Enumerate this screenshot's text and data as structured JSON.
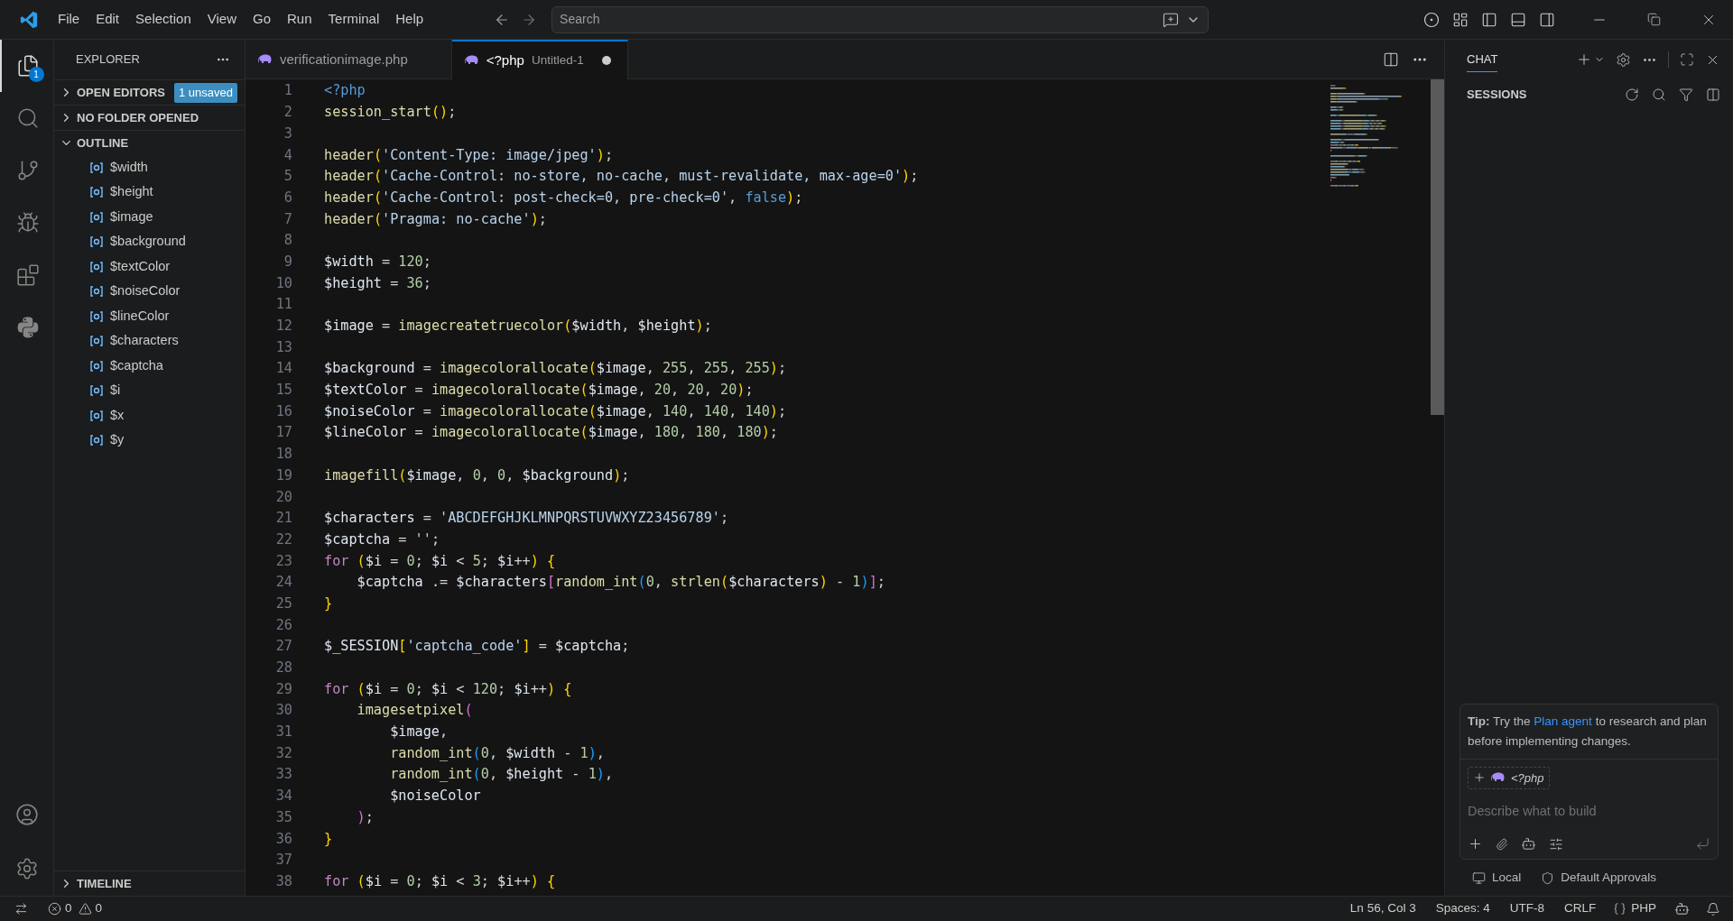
{
  "title_bar": {
    "menu": [
      "File",
      "Edit",
      "Selection",
      "View",
      "Go",
      "Run",
      "Terminal",
      "Help"
    ],
    "search": {
      "placeholder": "Search"
    }
  },
  "activity_bar": {
    "items": [
      {
        "kind": "files",
        "selected": true,
        "badge": "1"
      },
      {
        "kind": "search",
        "selected": false
      },
      {
        "kind": "source-control",
        "selected": false
      },
      {
        "kind": "run-debug",
        "selected": false
      },
      {
        "kind": "extensions",
        "selected": false
      },
      {
        "kind": "python",
        "selected": false
      }
    ],
    "bottom": [
      {
        "kind": "account"
      },
      {
        "kind": "settings"
      }
    ]
  },
  "sidebar": {
    "title": "EXPLORER",
    "sections": [
      {
        "label": "OPEN EDITORS",
        "expanded": false,
        "badge": "1 unsaved"
      },
      {
        "label": "NO FOLDER OPENED",
        "expanded": false
      },
      {
        "label": "OUTLINE",
        "expanded": true,
        "items": [
          "$width",
          "$height",
          "$image",
          "$background",
          "$textColor",
          "$noiseColor",
          "$lineColor",
          "$characters",
          "$captcha",
          "$i",
          "$x",
          "$y"
        ]
      },
      {
        "label": "TIMELINE",
        "expanded": false
      }
    ]
  },
  "editor": {
    "tabs": [
      {
        "label": "verificationimage.php",
        "selected": false,
        "modified": false
      },
      {
        "label": "<?php",
        "description": "Untitled-1",
        "selected": true,
        "modified": true
      }
    ],
    "lines": [
      {
        "number": "1",
        "tokens": [
          {
            "kind": "k",
            "text": "<?php"
          }
        ]
      },
      {
        "number": "2",
        "tokens": [
          {
            "kind": "f",
            "text": "session_start"
          },
          {
            "kind": "b1",
            "text": "()"
          },
          {
            "kind": "p",
            "text": ";"
          }
        ]
      },
      {
        "number": "3"
      },
      {
        "number": "4",
        "tokens": [
          {
            "kind": "f",
            "text": "header"
          },
          {
            "kind": "b1",
            "text": "("
          },
          {
            "kind": "s",
            "text": "'Content-Type: image/jpeg'"
          },
          {
            "kind": "b1",
            "text": ")"
          },
          {
            "kind": "p",
            "text": ";"
          }
        ]
      },
      {
        "number": "5",
        "tokens": [
          {
            "kind": "f",
            "text": "header"
          },
          {
            "kind": "b1",
            "text": "("
          },
          {
            "kind": "s",
            "text": "'Cache-Control: no-store, no-cache, must-revalidate, max-age=0'"
          },
          {
            "kind": "b1",
            "text": ")"
          },
          {
            "kind": "p",
            "text": ";"
          }
        ]
      },
      {
        "number": "6",
        "tokens": [
          {
            "kind": "f",
            "text": "header"
          },
          {
            "kind": "b1",
            "text": "("
          },
          {
            "kind": "s",
            "text": "'Cache-Control: post-check=0, pre-check=0'"
          },
          {
            "kind": "p",
            "text": ", "
          },
          {
            "kind": "k",
            "text": "false"
          },
          {
            "kind": "b1",
            "text": ")"
          },
          {
            "kind": "p",
            "text": ";"
          }
        ]
      },
      {
        "number": "7",
        "tokens": [
          {
            "kind": "f",
            "text": "header"
          },
          {
            "kind": "b1",
            "text": "("
          },
          {
            "kind": "s",
            "text": "'Pragma: no-cache'"
          },
          {
            "kind": "b1",
            "text": ")"
          },
          {
            "kind": "p",
            "text": ";"
          }
        ]
      },
      {
        "number": "8"
      },
      {
        "number": "9",
        "tokens": [
          {
            "kind": "v",
            "text": "$width"
          },
          {
            "kind": "p",
            "text": " = "
          },
          {
            "kind": "n",
            "text": "120"
          },
          {
            "kind": "p",
            "text": ";"
          }
        ]
      },
      {
        "number": "10",
        "tokens": [
          {
            "kind": "v",
            "text": "$height"
          },
          {
            "kind": "p",
            "text": " = "
          },
          {
            "kind": "n",
            "text": "36"
          },
          {
            "kind": "p",
            "text": ";"
          }
        ]
      },
      {
        "number": "11"
      },
      {
        "number": "12",
        "tokens": [
          {
            "kind": "v",
            "text": "$image"
          },
          {
            "kind": "p",
            "text": " = "
          },
          {
            "kind": "f",
            "text": "imagecreatetruecolor"
          },
          {
            "kind": "b1",
            "text": "("
          },
          {
            "kind": "v",
            "text": "$width"
          },
          {
            "kind": "p",
            "text": ", "
          },
          {
            "kind": "v",
            "text": "$height"
          },
          {
            "kind": "b1",
            "text": ")"
          },
          {
            "kind": "p",
            "text": ";"
          }
        ]
      },
      {
        "number": "13"
      },
      {
        "number": "14",
        "tokens": [
          {
            "kind": "v",
            "text": "$background"
          },
          {
            "kind": "p",
            "text": " = "
          },
          {
            "kind": "f",
            "text": "imagecolorallocate"
          },
          {
            "kind": "b1",
            "text": "("
          },
          {
            "kind": "v",
            "text": "$image"
          },
          {
            "kind": "p",
            "text": ", "
          },
          {
            "kind": "n",
            "text": "255"
          },
          {
            "kind": "p",
            "text": ", "
          },
          {
            "kind": "n",
            "text": "255"
          },
          {
            "kind": "p",
            "text": ", "
          },
          {
            "kind": "n",
            "text": "255"
          },
          {
            "kind": "b1",
            "text": ")"
          },
          {
            "kind": "p",
            "text": ";"
          }
        ]
      },
      {
        "number": "15",
        "tokens": [
          {
            "kind": "v",
            "text": "$textColor"
          },
          {
            "kind": "p",
            "text": " = "
          },
          {
            "kind": "f",
            "text": "imagecolorallocate"
          },
          {
            "kind": "b1",
            "text": "("
          },
          {
            "kind": "v",
            "text": "$image"
          },
          {
            "kind": "p",
            "text": ", "
          },
          {
            "kind": "n",
            "text": "20"
          },
          {
            "kind": "p",
            "text": ", "
          },
          {
            "kind": "n",
            "text": "20"
          },
          {
            "kind": "p",
            "text": ", "
          },
          {
            "kind": "n",
            "text": "20"
          },
          {
            "kind": "b1",
            "text": ")"
          },
          {
            "kind": "p",
            "text": ";"
          }
        ]
      },
      {
        "number": "16",
        "tokens": [
          {
            "kind": "v",
            "text": "$noiseColor"
          },
          {
            "kind": "p",
            "text": " = "
          },
          {
            "kind": "f",
            "text": "imagecolorallocate"
          },
          {
            "kind": "b1",
            "text": "("
          },
          {
            "kind": "v",
            "text": "$image"
          },
          {
            "kind": "p",
            "text": ", "
          },
          {
            "kind": "n",
            "text": "140"
          },
          {
            "kind": "p",
            "text": ", "
          },
          {
            "kind": "n",
            "text": "140"
          },
          {
            "kind": "p",
            "text": ", "
          },
          {
            "kind": "n",
            "text": "140"
          },
          {
            "kind": "b1",
            "text": ")"
          },
          {
            "kind": "p",
            "text": ";"
          }
        ]
      },
      {
        "number": "17",
        "tokens": [
          {
            "kind": "v",
            "text": "$lineColor"
          },
          {
            "kind": "p",
            "text": " = "
          },
          {
            "kind": "f",
            "text": "imagecolorallocate"
          },
          {
            "kind": "b1",
            "text": "("
          },
          {
            "kind": "v",
            "text": "$image"
          },
          {
            "kind": "p",
            "text": ", "
          },
          {
            "kind": "n",
            "text": "180"
          },
          {
            "kind": "p",
            "text": ", "
          },
          {
            "kind": "n",
            "text": "180"
          },
          {
            "kind": "p",
            "text": ", "
          },
          {
            "kind": "n",
            "text": "180"
          },
          {
            "kind": "b1",
            "text": ")"
          },
          {
            "kind": "p",
            "text": ";"
          }
        ]
      },
      {
        "number": "18"
      },
      {
        "number": "19",
        "tokens": [
          {
            "kind": "f",
            "text": "imagefill"
          },
          {
            "kind": "b1",
            "text": "("
          },
          {
            "kind": "v",
            "text": "$image"
          },
          {
            "kind": "p",
            "text": ", "
          },
          {
            "kind": "n",
            "text": "0"
          },
          {
            "kind": "p",
            "text": ", "
          },
          {
            "kind": "n",
            "text": "0"
          },
          {
            "kind": "p",
            "text": ", "
          },
          {
            "kind": "v",
            "text": "$background"
          },
          {
            "kind": "b1",
            "text": ")"
          },
          {
            "kind": "p",
            "text": ";"
          }
        ]
      },
      {
        "number": "20"
      },
      {
        "number": "21",
        "tokens": [
          {
            "kind": "v",
            "text": "$characters"
          },
          {
            "kind": "p",
            "text": " = "
          },
          {
            "kind": "s",
            "text": "'ABCDEFGHJKLMNPQRSTUVWXYZ23456789'"
          },
          {
            "kind": "p",
            "text": ";"
          }
        ]
      },
      {
        "number": "22",
        "tokens": [
          {
            "kind": "v",
            "text": "$captcha"
          },
          {
            "kind": "p",
            "text": " = "
          },
          {
            "kind": "s",
            "text": "''"
          },
          {
            "kind": "p",
            "text": ";"
          }
        ]
      },
      {
        "number": "23",
        "tokens": [
          {
            "kind": "c",
            "text": "for "
          },
          {
            "kind": "b1",
            "text": "("
          },
          {
            "kind": "v",
            "text": "$i"
          },
          {
            "kind": "p",
            "text": " = "
          },
          {
            "kind": "n",
            "text": "0"
          },
          {
            "kind": "p",
            "text": "; "
          },
          {
            "kind": "v",
            "text": "$i"
          },
          {
            "kind": "p",
            "text": " < "
          },
          {
            "kind": "n",
            "text": "5"
          },
          {
            "kind": "p",
            "text": "; "
          },
          {
            "kind": "v",
            "text": "$i"
          },
          {
            "kind": "p",
            "text": "++"
          },
          {
            "kind": "b1",
            "text": ") {"
          }
        ]
      },
      {
        "number": "24",
        "tokens": [
          {
            "kind": "v",
            "text": "    $captcha"
          },
          {
            "kind": "p",
            "text": " .= "
          },
          {
            "kind": "v",
            "text": "$characters"
          },
          {
            "kind": "b2",
            "text": "["
          },
          {
            "kind": "f",
            "text": "random_int"
          },
          {
            "kind": "b3",
            "text": "("
          },
          {
            "kind": "n",
            "text": "0"
          },
          {
            "kind": "p",
            "text": ", "
          },
          {
            "kind": "f",
            "text": "strlen"
          },
          {
            "kind": "b1",
            "text": "("
          },
          {
            "kind": "v",
            "text": "$characters"
          },
          {
            "kind": "b1",
            "text": ")"
          },
          {
            "kind": "p",
            "text": " - "
          },
          {
            "kind": "n",
            "text": "1"
          },
          {
            "kind": "b3",
            "text": ")"
          },
          {
            "kind": "b2",
            "text": "]"
          },
          {
            "kind": "p",
            "text": ";"
          }
        ]
      },
      {
        "number": "25",
        "tokens": [
          {
            "kind": "b1",
            "text": "}"
          }
        ]
      },
      {
        "number": "26"
      },
      {
        "number": "27",
        "tokens": [
          {
            "kind": "v",
            "text": "$_SESSION"
          },
          {
            "kind": "b1",
            "text": "["
          },
          {
            "kind": "s",
            "text": "'captcha_code'"
          },
          {
            "kind": "b1",
            "text": "]"
          },
          {
            "kind": "p",
            "text": " = "
          },
          {
            "kind": "v",
            "text": "$captcha"
          },
          {
            "kind": "p",
            "text": ";"
          }
        ]
      },
      {
        "number": "28"
      },
      {
        "number": "29",
        "tokens": [
          {
            "kind": "c",
            "text": "for "
          },
          {
            "kind": "b1",
            "text": "("
          },
          {
            "kind": "v",
            "text": "$i"
          },
          {
            "kind": "p",
            "text": " = "
          },
          {
            "kind": "n",
            "text": "0"
          },
          {
            "kind": "p",
            "text": "; "
          },
          {
            "kind": "v",
            "text": "$i"
          },
          {
            "kind": "p",
            "text": " < "
          },
          {
            "kind": "n",
            "text": "120"
          },
          {
            "kind": "p",
            "text": "; "
          },
          {
            "kind": "v",
            "text": "$i"
          },
          {
            "kind": "p",
            "text": "++"
          },
          {
            "kind": "b1",
            "text": ") {"
          }
        ]
      },
      {
        "number": "30",
        "tokens": [
          {
            "kind": "f",
            "text": "    imagesetpixel"
          },
          {
            "kind": "b2",
            "text": "("
          }
        ]
      },
      {
        "number": "31",
        "tokens": [
          {
            "kind": "v",
            "text": "        $image"
          },
          {
            "kind": "p",
            "text": ","
          }
        ]
      },
      {
        "number": "32",
        "tokens": [
          {
            "kind": "f",
            "text": "        random_int"
          },
          {
            "kind": "b3",
            "text": "("
          },
          {
            "kind": "n",
            "text": "0"
          },
          {
            "kind": "p",
            "text": ", "
          },
          {
            "kind": "v",
            "text": "$width"
          },
          {
            "kind": "p",
            "text": " - "
          },
          {
            "kind": "n",
            "text": "1"
          },
          {
            "kind": "b3",
            "text": ")"
          },
          {
            "kind": "p",
            "text": ","
          }
        ]
      },
      {
        "number": "33",
        "tokens": [
          {
            "kind": "f",
            "text": "        random_int"
          },
          {
            "kind": "b3",
            "text": "("
          },
          {
            "kind": "n",
            "text": "0"
          },
          {
            "kind": "p",
            "text": ", "
          },
          {
            "kind": "v",
            "text": "$height"
          },
          {
            "kind": "p",
            "text": " - "
          },
          {
            "kind": "n",
            "text": "1"
          },
          {
            "kind": "b3",
            "text": ")"
          },
          {
            "kind": "p",
            "text": ","
          }
        ]
      },
      {
        "number": "34",
        "tokens": [
          {
            "kind": "v",
            "text": "        $noiseColor"
          }
        ]
      },
      {
        "number": "35",
        "tokens": [
          {
            "kind": "b2",
            "text": "    )"
          },
          {
            "kind": "p",
            "text": ";"
          }
        ]
      },
      {
        "number": "36",
        "tokens": [
          {
            "kind": "b1",
            "text": "}"
          }
        ]
      },
      {
        "number": "37"
      },
      {
        "number": "38",
        "tokens": [
          {
            "kind": "c",
            "text": "for "
          },
          {
            "kind": "b1",
            "text": "("
          },
          {
            "kind": "v",
            "text": "$i"
          },
          {
            "kind": "p",
            "text": " = "
          },
          {
            "kind": "n",
            "text": "0"
          },
          {
            "kind": "p",
            "text": "; "
          },
          {
            "kind": "v",
            "text": "$i"
          },
          {
            "kind": "p",
            "text": " < "
          },
          {
            "kind": "n",
            "text": "3"
          },
          {
            "kind": "p",
            "text": "; "
          },
          {
            "kind": "v",
            "text": "$i"
          },
          {
            "kind": "p",
            "text": "++"
          },
          {
            "kind": "b1",
            "text": ") {"
          }
        ]
      }
    ]
  },
  "chat": {
    "tab": {
      "label": "CHAT",
      "selected": true
    },
    "sessions_title": "SESSIONS",
    "tip": {
      "lead": "Tip:",
      "before": "Try the",
      "link": "Plan agent",
      "after": "to research and plan before implementing changes."
    },
    "context_chip": "<?php",
    "input": {
      "placeholder": "Describe what to build"
    },
    "footer": [
      {
        "kind": "local",
        "label": "Local"
      },
      {
        "kind": "approvals",
        "label": "Default Approvals"
      }
    ]
  },
  "status_bar": {
    "errors": "0",
    "warnings": "0",
    "items": [
      "Ln 56, Col 3",
      "Spaces: 4",
      "UTF-8",
      "CRLF"
    ],
    "language": "PHP"
  }
}
